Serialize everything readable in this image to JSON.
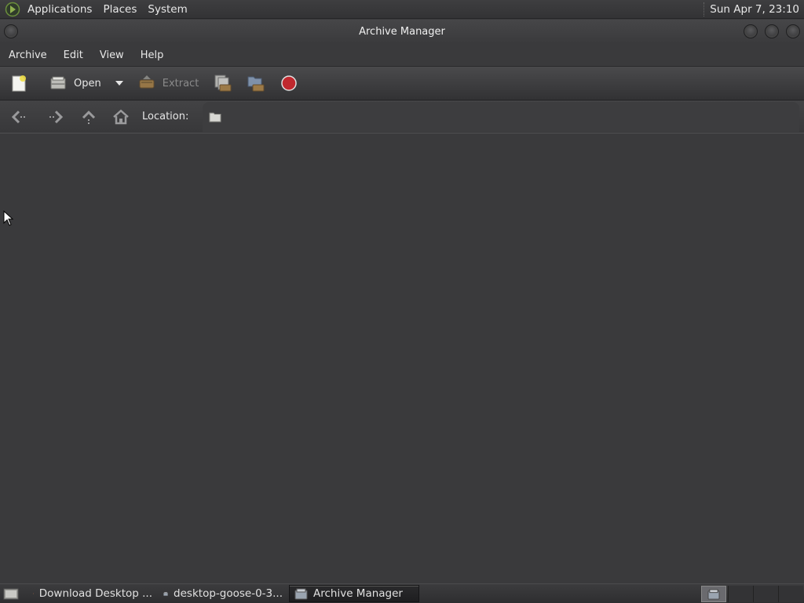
{
  "top_panel": {
    "menus": [
      "Applications",
      "Places",
      "System"
    ],
    "clock": "Sun Apr  7, 23:10"
  },
  "window": {
    "title": "Archive Manager"
  },
  "menubar": {
    "items": [
      "Archive",
      "Edit",
      "View",
      "Help"
    ]
  },
  "toolbar": {
    "new_icon": "new-archive-icon",
    "open_label": "Open",
    "extract_label": "Extract",
    "add_files_icon": "add-files-icon",
    "add_folder_icon": "add-folder-icon",
    "stop_icon": "stop-icon"
  },
  "locationbar": {
    "label": "Location:",
    "value": ""
  },
  "taskbar": {
    "tasks": [
      {
        "label": "Download Desktop ...",
        "icon": "chrome-icon",
        "active": false
      },
      {
        "label": "desktop-goose-0-3...",
        "icon": "archive-icon",
        "active": false
      },
      {
        "label": "Archive Manager",
        "icon": "archive-icon",
        "active": true
      }
    ]
  },
  "colors": {
    "background": "#3a3a3c",
    "text": "#e6e6e6",
    "stop_red": "#c0282e"
  }
}
